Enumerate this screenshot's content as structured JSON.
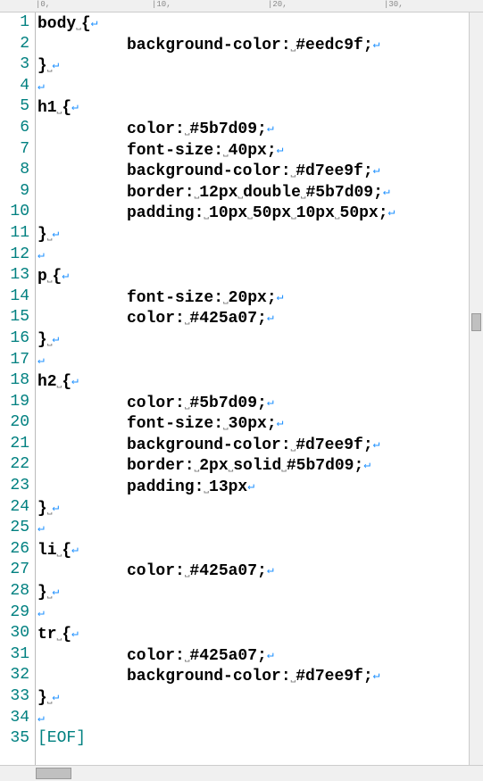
{
  "ruler_marks": [
    "|0,",
    "|10,",
    "|20,",
    "|30,"
  ],
  "eof_label": "[EOF]",
  "whitespace_glyph": "⎵",
  "return_glyph": "↵",
  "lines": [
    {
      "n": 1,
      "seg": [
        [
          "kw",
          "body"
        ],
        [
          "sym",
          "⎵"
        ],
        [
          "kw",
          "{"
        ],
        [
          "ret",
          "↵"
        ]
      ]
    },
    {
      "n": 2,
      "seg": [
        [
          "tab",
          ""
        ],
        [
          "kw",
          "background-color:"
        ],
        [
          "sym",
          "⎵"
        ],
        [
          "kw",
          "#eedc9f;"
        ],
        [
          "ret",
          "↵"
        ]
      ]
    },
    {
      "n": 3,
      "seg": [
        [
          "kw",
          "}"
        ],
        [
          "sym",
          "⎵"
        ],
        [
          "ret",
          "↵"
        ]
      ]
    },
    {
      "n": 4,
      "seg": [
        [
          "ret",
          "↵"
        ]
      ]
    },
    {
      "n": 5,
      "seg": [
        [
          "kw",
          "h1"
        ],
        [
          "sym",
          "⎵"
        ],
        [
          "kw",
          "{"
        ],
        [
          "ret",
          "↵"
        ]
      ]
    },
    {
      "n": 6,
      "seg": [
        [
          "tab",
          ""
        ],
        [
          "kw",
          "color:"
        ],
        [
          "sym",
          "⎵"
        ],
        [
          "kw",
          "#5b7d09;"
        ],
        [
          "ret",
          "↵"
        ]
      ]
    },
    {
      "n": 7,
      "seg": [
        [
          "tab",
          ""
        ],
        [
          "kw",
          "font-size:"
        ],
        [
          "sym",
          "⎵"
        ],
        [
          "kw",
          "40px;"
        ],
        [
          "ret",
          "↵"
        ]
      ]
    },
    {
      "n": 8,
      "seg": [
        [
          "tab",
          ""
        ],
        [
          "kw",
          "background-color:"
        ],
        [
          "sym",
          "⎵"
        ],
        [
          "kw",
          "#d7ee9f;"
        ],
        [
          "ret",
          "↵"
        ]
      ]
    },
    {
      "n": 9,
      "seg": [
        [
          "tab",
          ""
        ],
        [
          "kw",
          "border:"
        ],
        [
          "sym",
          "⎵"
        ],
        [
          "kw",
          "12px"
        ],
        [
          "sym",
          "⎵"
        ],
        [
          "kw",
          "double"
        ],
        [
          "sym",
          "⎵"
        ],
        [
          "kw",
          "#5b7d09;"
        ],
        [
          "ret",
          "↵"
        ]
      ]
    },
    {
      "n": 10,
      "seg": [
        [
          "tab",
          ""
        ],
        [
          "kw",
          "padding:"
        ],
        [
          "sym",
          "⎵"
        ],
        [
          "kw",
          "10px"
        ],
        [
          "sym",
          "⎵"
        ],
        [
          "kw",
          "50px"
        ],
        [
          "sym",
          "⎵"
        ],
        [
          "kw",
          "10px"
        ],
        [
          "sym",
          "⎵"
        ],
        [
          "kw",
          "50px;"
        ],
        [
          "ret",
          "↵"
        ]
      ]
    },
    {
      "n": 11,
      "seg": [
        [
          "kw",
          "}"
        ],
        [
          "sym",
          "⎵"
        ],
        [
          "ret",
          "↵"
        ]
      ]
    },
    {
      "n": 12,
      "seg": [
        [
          "ret",
          "↵"
        ]
      ]
    },
    {
      "n": 13,
      "seg": [
        [
          "kw",
          "p"
        ],
        [
          "sym",
          "⎵"
        ],
        [
          "kw",
          "{"
        ],
        [
          "ret",
          "↵"
        ]
      ]
    },
    {
      "n": 14,
      "seg": [
        [
          "tab",
          ""
        ],
        [
          "kw",
          "font-size:"
        ],
        [
          "sym",
          "⎵"
        ],
        [
          "kw",
          "20px;"
        ],
        [
          "ret",
          "↵"
        ]
      ]
    },
    {
      "n": 15,
      "seg": [
        [
          "tab",
          ""
        ],
        [
          "kw",
          "color:"
        ],
        [
          "sym",
          "⎵"
        ],
        [
          "kw",
          "#425a07;"
        ],
        [
          "ret",
          "↵"
        ]
      ]
    },
    {
      "n": 16,
      "seg": [
        [
          "kw",
          "}"
        ],
        [
          "sym",
          "⎵"
        ],
        [
          "ret",
          "↵"
        ]
      ]
    },
    {
      "n": 17,
      "seg": [
        [
          "ret",
          "↵"
        ]
      ]
    },
    {
      "n": 18,
      "seg": [
        [
          "kw",
          "h2"
        ],
        [
          "sym",
          "⎵"
        ],
        [
          "kw",
          "{"
        ],
        [
          "ret",
          "↵"
        ]
      ]
    },
    {
      "n": 19,
      "seg": [
        [
          "tab",
          ""
        ],
        [
          "kw",
          "color:"
        ],
        [
          "sym",
          "⎵"
        ],
        [
          "kw",
          "#5b7d09;"
        ],
        [
          "ret",
          "↵"
        ]
      ]
    },
    {
      "n": 20,
      "seg": [
        [
          "tab",
          ""
        ],
        [
          "kw",
          "font-size:"
        ],
        [
          "sym",
          "⎵"
        ],
        [
          "kw",
          "30px;"
        ],
        [
          "ret",
          "↵"
        ]
      ]
    },
    {
      "n": 21,
      "seg": [
        [
          "tab",
          ""
        ],
        [
          "kw",
          "background-color:"
        ],
        [
          "sym",
          "⎵"
        ],
        [
          "kw",
          "#d7ee9f;"
        ],
        [
          "ret",
          "↵"
        ]
      ]
    },
    {
      "n": 22,
      "seg": [
        [
          "tab",
          ""
        ],
        [
          "kw",
          "border:"
        ],
        [
          "sym",
          "⎵"
        ],
        [
          "kw",
          "2px"
        ],
        [
          "sym",
          "⎵"
        ],
        [
          "kw",
          "solid"
        ],
        [
          "sym",
          "⎵"
        ],
        [
          "kw",
          "#5b7d09;"
        ],
        [
          "ret",
          "↵"
        ]
      ]
    },
    {
      "n": 23,
      "seg": [
        [
          "tab",
          ""
        ],
        [
          "kw",
          "padding:"
        ],
        [
          "sym",
          "⎵"
        ],
        [
          "kw",
          "13px"
        ],
        [
          "ret",
          "↵"
        ]
      ]
    },
    {
      "n": 24,
      "seg": [
        [
          "kw",
          "}"
        ],
        [
          "sym",
          "⎵"
        ],
        [
          "ret",
          "↵"
        ]
      ]
    },
    {
      "n": 25,
      "seg": [
        [
          "ret",
          "↵"
        ]
      ]
    },
    {
      "n": 26,
      "seg": [
        [
          "kw",
          "li"
        ],
        [
          "sym",
          "⎵"
        ],
        [
          "kw",
          "{"
        ],
        [
          "ret",
          "↵"
        ]
      ]
    },
    {
      "n": 27,
      "seg": [
        [
          "tab",
          ""
        ],
        [
          "kw",
          "color:"
        ],
        [
          "sym",
          "⎵"
        ],
        [
          "kw",
          "#425a07;"
        ],
        [
          "ret",
          "↵"
        ]
      ]
    },
    {
      "n": 28,
      "seg": [
        [
          "kw",
          "}"
        ],
        [
          "sym",
          "⎵"
        ],
        [
          "ret",
          "↵"
        ]
      ]
    },
    {
      "n": 29,
      "seg": [
        [
          "ret",
          "↵"
        ]
      ]
    },
    {
      "n": 30,
      "seg": [
        [
          "kw",
          "tr"
        ],
        [
          "sym",
          "⎵"
        ],
        [
          "kw",
          "{"
        ],
        [
          "ret",
          "↵"
        ]
      ]
    },
    {
      "n": 31,
      "seg": [
        [
          "tab",
          ""
        ],
        [
          "kw",
          "color:"
        ],
        [
          "sym",
          "⎵"
        ],
        [
          "kw",
          "#425a07;"
        ],
        [
          "ret",
          "↵"
        ]
      ]
    },
    {
      "n": 32,
      "seg": [
        [
          "tab",
          ""
        ],
        [
          "kw",
          "background-color:"
        ],
        [
          "sym",
          "⎵"
        ],
        [
          "kw",
          "#d7ee9f;"
        ],
        [
          "ret",
          "↵"
        ]
      ]
    },
    {
      "n": 33,
      "seg": [
        [
          "kw",
          "}"
        ],
        [
          "sym",
          "⎵"
        ],
        [
          "ret",
          "↵"
        ]
      ]
    },
    {
      "n": 34,
      "seg": [
        [
          "ret",
          "↵"
        ]
      ]
    },
    {
      "n": 35,
      "seg": [
        [
          "eof",
          "[EOF]"
        ]
      ]
    }
  ]
}
